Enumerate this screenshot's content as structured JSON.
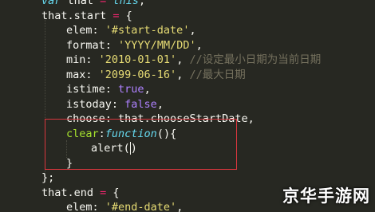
{
  "editor": {
    "lines": [
      {
        "id": 0,
        "tokens": [
          [
            "kw",
            "var"
          ],
          [
            "pun",
            " that "
          ],
          [
            "op",
            "="
          ],
          [
            "pun",
            " "
          ],
          [
            "kw2",
            "this"
          ],
          [
            "pun",
            ";"
          ]
        ]
      },
      {
        "id": 1,
        "tokens": [
          [
            "prop",
            "that.start "
          ],
          [
            "op",
            "="
          ],
          [
            "pun",
            " {"
          ]
        ]
      },
      {
        "id": 2,
        "tokens": [
          [
            "prop",
            "elem"
          ],
          [
            "pun",
            ": "
          ],
          [
            "str",
            "'#start-date'"
          ],
          [
            "pun",
            ","
          ]
        ]
      },
      {
        "id": 3,
        "tokens": [
          [
            "prop",
            "format"
          ],
          [
            "pun",
            ": "
          ],
          [
            "str",
            "'YYYY/MM/DD'"
          ],
          [
            "pun",
            ","
          ]
        ]
      },
      {
        "id": 4,
        "tokens": [
          [
            "prop",
            "min"
          ],
          [
            "pun",
            ": "
          ],
          [
            "str",
            "'2010-01-01'"
          ],
          [
            "pun",
            ", "
          ],
          [
            "cm",
            "//设定最小日期为当前日期"
          ]
        ]
      },
      {
        "id": 5,
        "tokens": [
          [
            "prop",
            "max"
          ],
          [
            "pun",
            ": "
          ],
          [
            "str",
            "'2099-06-16'"
          ],
          [
            "pun",
            ", "
          ],
          [
            "cm",
            "//最大日期"
          ]
        ]
      },
      {
        "id": 6,
        "tokens": [
          [
            "prop",
            "istime"
          ],
          [
            "pun",
            ": "
          ],
          [
            "bool",
            "true"
          ],
          [
            "pun",
            ","
          ]
        ]
      },
      {
        "id": 7,
        "tokens": [
          [
            "prop",
            "istoday"
          ],
          [
            "pun",
            ": "
          ],
          [
            "bool",
            "false"
          ],
          [
            "pun",
            ","
          ]
        ]
      },
      {
        "id": 8,
        "tokens": [
          [
            "prop",
            "choose"
          ],
          [
            "pun",
            ": that.chooseStartDate,"
          ]
        ]
      },
      {
        "id": 9,
        "tokens": [
          [
            "fn",
            "clear"
          ],
          [
            "pun",
            ":"
          ],
          [
            "fnkw",
            "function"
          ],
          [
            "pun",
            "(){"
          ]
        ]
      },
      {
        "id": 10,
        "tokens": [
          [
            "prop",
            "alert"
          ],
          [
            "pun",
            "("
          ],
          [
            "cursor",
            ""
          ],
          [
            "pun",
            ")"
          ]
        ]
      },
      {
        "id": 11,
        "tokens": [
          [
            "pun",
            "}"
          ]
        ]
      },
      {
        "id": 12,
        "tokens": [
          [
            "pun",
            "};"
          ]
        ]
      },
      {
        "id": 13,
        "tokens": [
          [
            "prop",
            "that.end "
          ],
          [
            "op",
            "="
          ],
          [
            "pun",
            " {"
          ]
        ]
      },
      {
        "id": 14,
        "tokens": [
          [
            "prop",
            "elem"
          ],
          [
            "pun",
            ": "
          ],
          [
            "str",
            "'#end-date'"
          ],
          [
            "pun",
            ","
          ]
        ]
      }
    ]
  },
  "watermark": {
    "text": "京华手游网"
  }
}
